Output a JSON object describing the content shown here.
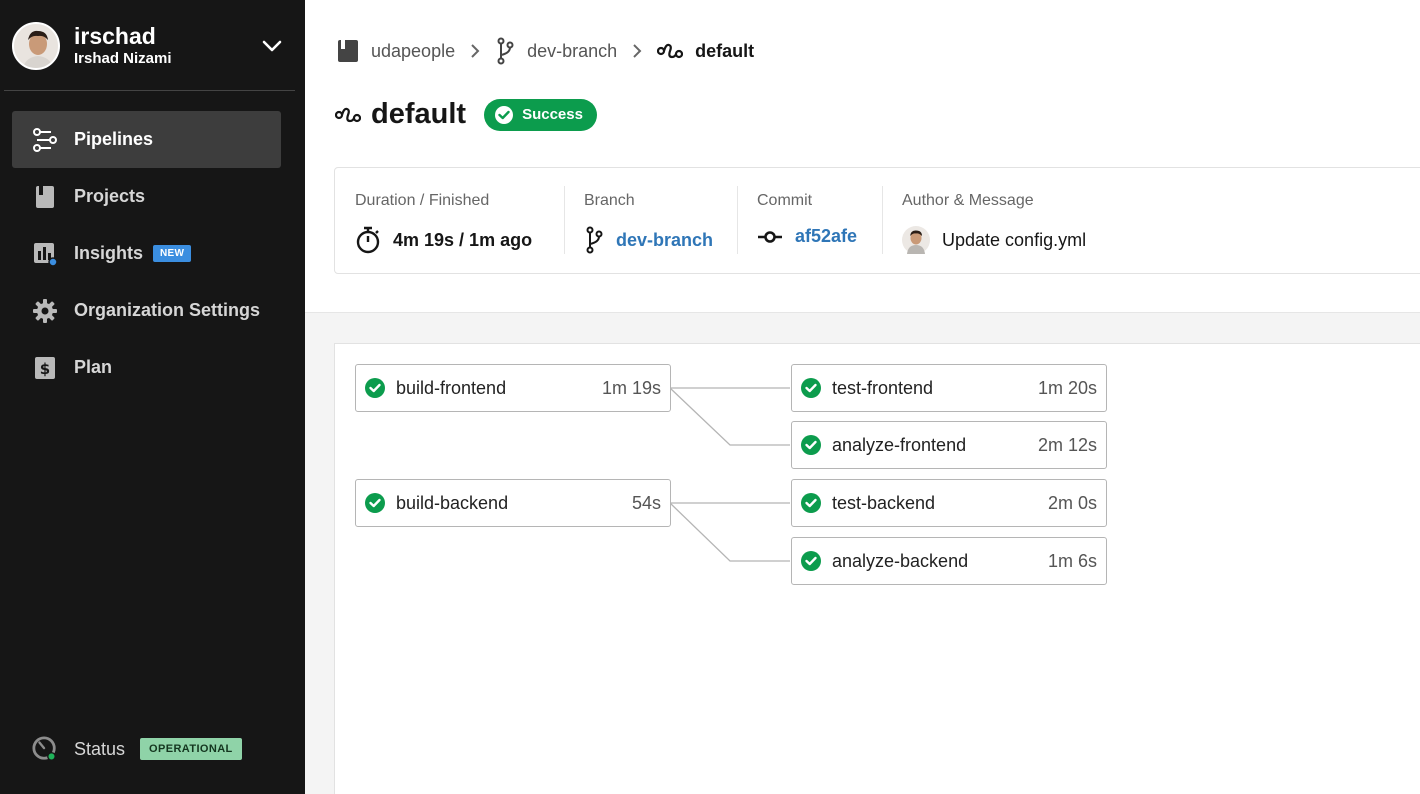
{
  "user": {
    "handle": "irschad",
    "name": "Irshad Nizami"
  },
  "sidebar": {
    "items": [
      {
        "label": "Pipelines",
        "icon": "pipelines-icon",
        "active": true
      },
      {
        "label": "Projects",
        "icon": "book-icon"
      },
      {
        "label": "Insights",
        "icon": "insights-icon",
        "badge": "NEW"
      },
      {
        "label": "Organization Settings",
        "icon": "gear-icon"
      },
      {
        "label": "Plan",
        "icon": "dollar-icon"
      }
    ],
    "status": {
      "label": "Status",
      "badge": "OPERATIONAL"
    }
  },
  "breadcrumb": {
    "project": "udapeople",
    "branch": "dev-branch",
    "workflow": "default"
  },
  "workflow": {
    "name": "default",
    "status": "Success"
  },
  "details": {
    "duration_label": "Duration / Finished",
    "duration_value": "4m 19s / 1m ago",
    "branch_label": "Branch",
    "branch_value": "dev-branch",
    "commit_label": "Commit",
    "commit_value": "af52afe",
    "author_label": "Author & Message",
    "author_message": "Update config.yml"
  },
  "jobs": [
    {
      "name": "build-frontend",
      "duration": "1m 19s",
      "status": "success"
    },
    {
      "name": "test-frontend",
      "duration": "1m 20s",
      "status": "success"
    },
    {
      "name": "analyze-frontend",
      "duration": "2m 12s",
      "status": "success"
    },
    {
      "name": "build-backend",
      "duration": "54s",
      "status": "success"
    },
    {
      "name": "test-backend",
      "duration": "2m 0s",
      "status": "success"
    },
    {
      "name": "analyze-backend",
      "duration": "1m 6s",
      "status": "success"
    }
  ],
  "colors": {
    "sidebar_bg": "#161616",
    "success": "#0c9c4d",
    "link": "#2f76b7",
    "new_badge": "#3b8ee0",
    "operational_badge": "#8fd3a8"
  }
}
